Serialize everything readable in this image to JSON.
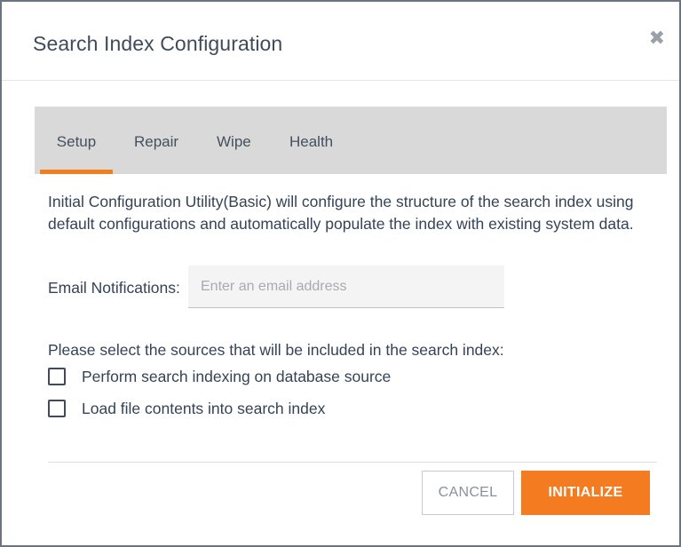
{
  "dialog": {
    "title": "Search Index Configuration",
    "close_glyph": "✖",
    "close_icon": "close-icon"
  },
  "tabs": [
    {
      "label": "Setup",
      "active": true
    },
    {
      "label": "Repair",
      "active": false
    },
    {
      "label": "Wipe",
      "active": false
    },
    {
      "label": "Health",
      "active": false
    }
  ],
  "description": "Initial Configuration Utility(Basic) will configure the structure of the search index using default configurations and automatically populate the index with existing system data.",
  "email": {
    "label": "Email Notifications:",
    "placeholder": "Enter an email address",
    "value": ""
  },
  "sources": {
    "label": "Please select the sources that will be included in the search index:",
    "options": [
      {
        "label": "Perform search indexing on database source",
        "checked": false
      },
      {
        "label": "Load file contents into search index",
        "checked": false
      }
    ]
  },
  "buttons": {
    "cancel": "CANCEL",
    "initialize": "INITIALIZE"
  },
  "colors": {
    "accent": "#f47b20",
    "tab_bar": "#d9d9d9",
    "text": "#354356"
  }
}
